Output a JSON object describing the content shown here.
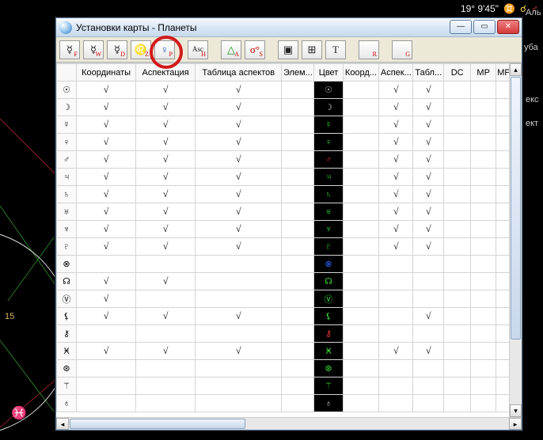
{
  "status_top": {
    "coord": "19° 9'45\"",
    "sign_glyph": "♊",
    "aspect_glyph": "☌",
    "planet_glyph": "♂"
  },
  "side_labels": {
    "al": "Аль",
    "uba": "уба",
    "eks": "екс",
    "ekt": "ект",
    "num15": "15"
  },
  "window": {
    "title": "Установки карты - Планеты"
  },
  "win_buttons": {
    "min": "—",
    "max": "▭",
    "close": "✕"
  },
  "toolbar": [
    {
      "name": "toolbar-f",
      "sym": "☿",
      "sub": "F"
    },
    {
      "name": "toolbar-w",
      "sym": "☿",
      "sub": "W"
    },
    {
      "name": "toolbar-d",
      "sym": "☿",
      "sub": "D"
    },
    {
      "name": "toolbar-z",
      "sym": "♌",
      "sub": "Z",
      "symClass": "orange"
    },
    {
      "name": "toolbar-p",
      "sym": "♀",
      "sub": "P",
      "symClass": "blue"
    },
    {
      "name": "toolbar-h",
      "sym": "Asc",
      "sub": "H",
      "small": true
    },
    {
      "name": "toolbar-a",
      "sym": "△",
      "sub": "A",
      "symClass": "green"
    },
    {
      "name": "toolbar-s",
      "sym": "σ°",
      "sub": "S",
      "symClass": "red"
    },
    {
      "name": "toolbar-sq1",
      "sym": "▣",
      "sub": ""
    },
    {
      "name": "toolbar-sq2",
      "sym": "⊞",
      "sub": ""
    },
    {
      "name": "toolbar-t",
      "sym": "T",
      "sub": ""
    },
    {
      "name": "toolbar-r",
      "sym": "",
      "sub": "R"
    },
    {
      "name": "toolbar-g",
      "sym": "",
      "sub": "G"
    }
  ],
  "gaps_after": [
    4,
    5,
    7,
    10,
    11
  ],
  "highlighted_toolbar_index": 4,
  "columns": [
    {
      "key": "rowhdr",
      "label": ""
    },
    {
      "key": "coord",
      "label": "Координаты"
    },
    {
      "key": "asp",
      "label": "Аспектация"
    },
    {
      "key": "tab",
      "label": "Таблица аспектов"
    },
    {
      "key": "elem",
      "label": "Элем..."
    },
    {
      "key": "color",
      "label": "Цвет"
    },
    {
      "key": "coord2",
      "label": "Коорд..."
    },
    {
      "key": "asp2",
      "label": "Аспек..."
    },
    {
      "key": "tab2",
      "label": "Табл..."
    },
    {
      "key": "dc",
      "label": "DC"
    },
    {
      "key": "mp",
      "label": "MP"
    },
    {
      "key": "mp2",
      "label": "MP ↗"
    }
  ],
  "rows": [
    {
      "glyph": "☉",
      "cc": "gray",
      "cells": {
        "coord": 1,
        "asp": 1,
        "tab": 1,
        "asp2": 1,
        "tab2": 1
      }
    },
    {
      "glyph": "☽",
      "cc": "gray",
      "cells": {
        "coord": 1,
        "asp": 1,
        "tab": 1,
        "asp2": 1,
        "tab2": 1
      }
    },
    {
      "glyph": "☿",
      "cc": "",
      "cells": {
        "coord": 1,
        "asp": 1,
        "tab": 1,
        "asp2": 1,
        "tab2": 1
      }
    },
    {
      "glyph": "♀",
      "cc": "",
      "cells": {
        "coord": 1,
        "asp": 1,
        "tab": 1,
        "asp2": 1,
        "tab2": 1
      }
    },
    {
      "glyph": "♂",
      "cc": "red",
      "cells": {
        "coord": 1,
        "asp": 1,
        "tab": 1,
        "asp2": 1,
        "tab2": 1
      }
    },
    {
      "glyph": "♃",
      "cc": "",
      "cells": {
        "coord": 1,
        "asp": 1,
        "tab": 1,
        "asp2": 1,
        "tab2": 1
      }
    },
    {
      "glyph": "♄",
      "cc": "",
      "cells": {
        "coord": 1,
        "asp": 1,
        "tab": 1,
        "asp2": 1,
        "tab2": 1
      }
    },
    {
      "glyph": "♅",
      "cc": "",
      "cells": {
        "coord": 1,
        "asp": 1,
        "tab": 1,
        "asp2": 1,
        "tab2": 1
      }
    },
    {
      "glyph": "♆",
      "cc": "",
      "cells": {
        "coord": 1,
        "asp": 1,
        "tab": 1,
        "asp2": 1,
        "tab2": 1
      }
    },
    {
      "glyph": "♇",
      "cc": "",
      "cells": {
        "coord": 1,
        "asp": 1,
        "tab": 1,
        "asp2": 1,
        "tab2": 1
      }
    },
    {
      "glyph": "⊗",
      "cc": "blue",
      "cells": {}
    },
    {
      "glyph": "☊",
      "cc": "",
      "cells": {
        "coord": 1,
        "asp": 1
      }
    },
    {
      "glyph": "Ⓥ",
      "cc": "",
      "cells": {
        "coord": 1
      }
    },
    {
      "glyph": "⚸",
      "cc": "",
      "cells": {
        "coord": 1,
        "asp": 1,
        "tab": 1,
        "tab2": 1
      }
    },
    {
      "glyph": "⚷",
      "cc": "red",
      "cells": {}
    },
    {
      "glyph": "Ӿ",
      "cc": "",
      "cells": {
        "coord": 1,
        "asp": 1,
        "tab": 1,
        "asp2": 1,
        "tab2": 1
      }
    },
    {
      "glyph": "⊛",
      "cc": "",
      "cells": {}
    },
    {
      "glyph": "⚚",
      "cc": "",
      "cells": {}
    },
    {
      "glyph": "♁",
      "cc": "gray",
      "cells": {}
    }
  ],
  "checkmark": "√"
}
